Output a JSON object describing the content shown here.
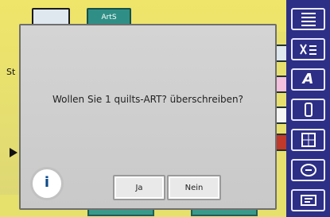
{
  "colors": {
    "background_yellow": "#e9e37a",
    "dialog_bg": "#c9c9c9",
    "toolbar_bg": "#2d2f86",
    "accent_teal": "#2f8f86",
    "info_blue": "#0c4a8a"
  },
  "top": {
    "left_tab_label": "",
    "mid_tab_label": "ArtS"
  },
  "left": {
    "label": "St"
  },
  "dialog": {
    "message": "Wollen Sie 1 quilts-ART? überschreiben?",
    "buttons": {
      "yes": "Ja",
      "no": "Nein"
    },
    "icon": "info-icon"
  },
  "toolbar": {
    "items": [
      {
        "name": "stitch-menu-icon"
      },
      {
        "name": "quilt-stitch-icon"
      },
      {
        "name": "alphabet-icon",
        "label": "A"
      },
      {
        "name": "buttonhole-icon"
      },
      {
        "name": "embroidery-grid-icon"
      },
      {
        "name": "memory-icon"
      },
      {
        "name": "setup-icon"
      }
    ]
  }
}
